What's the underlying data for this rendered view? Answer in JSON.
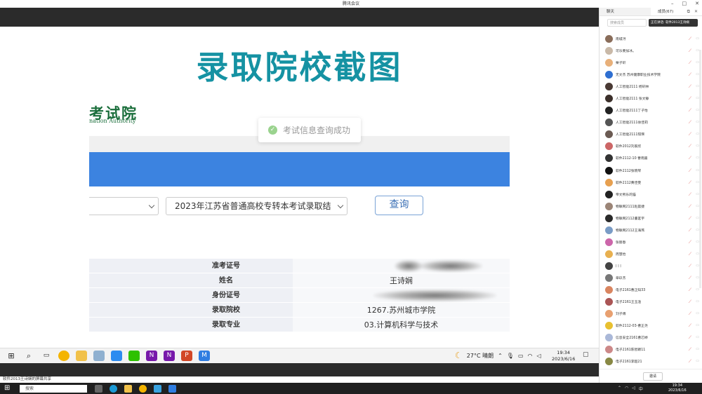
{
  "window": {
    "title": "腾讯会议",
    "controls": [
      "–",
      "□",
      "✕"
    ]
  },
  "slide": {
    "title": "录取院校截图",
    "logo_cn": "考试院",
    "logo_en": "nation Authority",
    "toast": "考试信息查询成功",
    "select_value": "2023年江苏省普通高校专转本考试录取结",
    "query_button": "查询",
    "table": [
      {
        "label": "准考证号",
        "value": ""
      },
      {
        "label": "姓名",
        "value": "王诗娴"
      },
      {
        "label": "身份证号",
        "value": ""
      },
      {
        "label": "录取院校",
        "value": "1267.苏州城市学院"
      },
      {
        "label": "录取专业",
        "value": "03.计算机科学与技术"
      }
    ],
    "accent_color": "#1592a3",
    "bar_color": "#3c83e0"
  },
  "taskbar_inner": {
    "weather": "27°C 晴朗",
    "time": "19:34",
    "date": "2023/6/16"
  },
  "share_status": "软件2013王诗娴的屏幕共享",
  "taskbar_outer": {
    "search_placeholder": "搜索",
    "ime": "中",
    "time": "19:34",
    "date": "2023/6/16"
  },
  "panel": {
    "tab_chat": "聊天",
    "tab_members": "成员(67)",
    "search_placeholder": "搜索成员",
    "speaking": "正在讲话: 软件2013王诗娴",
    "invite_button": "邀请",
    "members": [
      {
        "name": "南城浔",
        "color": "#8a6d5a"
      },
      {
        "name": "可乐要加冰。",
        "color": "#c9b9a8"
      },
      {
        "name": "栗子轩",
        "color": "#e8b07a"
      },
      {
        "name": "无文杰 苏州健康职业技术学院",
        "color": "#2f6fd1"
      },
      {
        "name": "人工智能2111 杨轩林",
        "color": "#4a3a34"
      },
      {
        "name": "人工智能2111 张文静",
        "color": "#3b2f2a"
      },
      {
        "name": "人工智能2111丁子怡",
        "color": "#222"
      },
      {
        "name": "人工智能2111徐佳莉",
        "color": "#555"
      },
      {
        "name": "人工智能2111琪瑛",
        "color": "#6b5b53"
      },
      {
        "name": "软件2012刘家欣",
        "color": "#c66"
      },
      {
        "name": "软件2112-10 曹雨嘉",
        "color": "#333"
      },
      {
        "name": "软件2112张晓琴",
        "color": "#111"
      },
      {
        "name": "软件2112黄佳雯",
        "color": "#e7a050"
      },
      {
        "name": "帝文熙乐的猫",
        "color": "#222"
      },
      {
        "name": "物联网2111赵晨捷",
        "color": "#9b8577"
      },
      {
        "name": "物联网2112董茗宇",
        "color": "#2a2a2a"
      },
      {
        "name": "物联网2112王海燕",
        "color": "#7a9cc6"
      },
      {
        "name": "张丽春",
        "color": "#c6a"
      },
      {
        "name": "周慧怡",
        "color": "#e8b050"
      },
      {
        "name": "| | |",
        "color": "#444"
      },
      {
        "name": "章玖杰",
        "color": "#777"
      },
      {
        "name": "电子2161曹正知33",
        "color": "#d98560"
      },
      {
        "name": "电子2161王玉淦",
        "color": "#a55"
      },
      {
        "name": "刘子傅",
        "color": "#e8a070"
      },
      {
        "name": "软件2112-03-曹正尧",
        "color": "#e8c030"
      },
      {
        "name": "信息安全2161曹芯婷",
        "color": "#aab8d8"
      },
      {
        "name": "电子2161陈智颖11",
        "color": "#c88"
      },
      {
        "name": "电子2161李超21",
        "color": "#884"
      }
    ]
  }
}
